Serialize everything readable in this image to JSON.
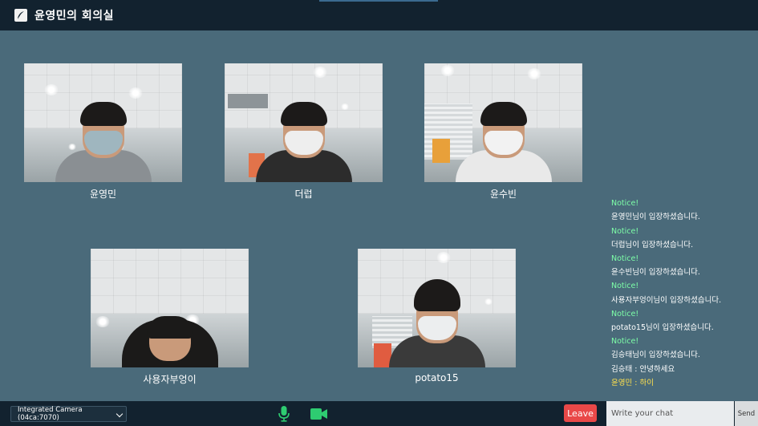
{
  "header": {
    "room_title": "윤영민의 회의실"
  },
  "participants": [
    {
      "name": "윤영민"
    },
    {
      "name": "더럽"
    },
    {
      "name": "윤수빈"
    },
    {
      "name": "사용자부엉이"
    },
    {
      "name": "potato15"
    }
  ],
  "chat": {
    "messages": [
      {
        "type": "notice",
        "text": "Notice!"
      },
      {
        "type": "text",
        "text": "윤영민님이 입장하셨습니다."
      },
      {
        "type": "notice",
        "text": "Notice!"
      },
      {
        "type": "text",
        "text": "더럽님이 입장하셨습니다."
      },
      {
        "type": "notice",
        "text": "Notice!"
      },
      {
        "type": "text",
        "text": "윤수빈님이 입장하셨습니다."
      },
      {
        "type": "notice",
        "text": "Notice!"
      },
      {
        "type": "text",
        "text": "사용자부엉이님이 입장하셨습니다."
      },
      {
        "type": "notice",
        "text": "Notice!"
      },
      {
        "type": "text",
        "text": "potato15님이 입장하셨습니다."
      },
      {
        "type": "notice",
        "text": "Notice!"
      },
      {
        "type": "text",
        "text": "김승태님이 입장하셨습니다."
      },
      {
        "type": "text",
        "text": "김승태 : 안녕하세요"
      },
      {
        "type": "self",
        "text": "윤영민 : 하이"
      }
    ],
    "input_placeholder": "Write your chat",
    "send_label": "Send"
  },
  "controls": {
    "camera_selected": "Integrated Camera (04ca:7070)",
    "mic_icon": "microphone-icon",
    "video_icon": "video-camera-icon",
    "leave_label": "Leave"
  },
  "colors": {
    "header_bg": "#12222f",
    "stage_bg": "#4a6a7a",
    "notice": "#7dffa8",
    "self_message": "#ffe14d",
    "mic_green": "#2ecc71",
    "leave_red": "#e94848"
  }
}
